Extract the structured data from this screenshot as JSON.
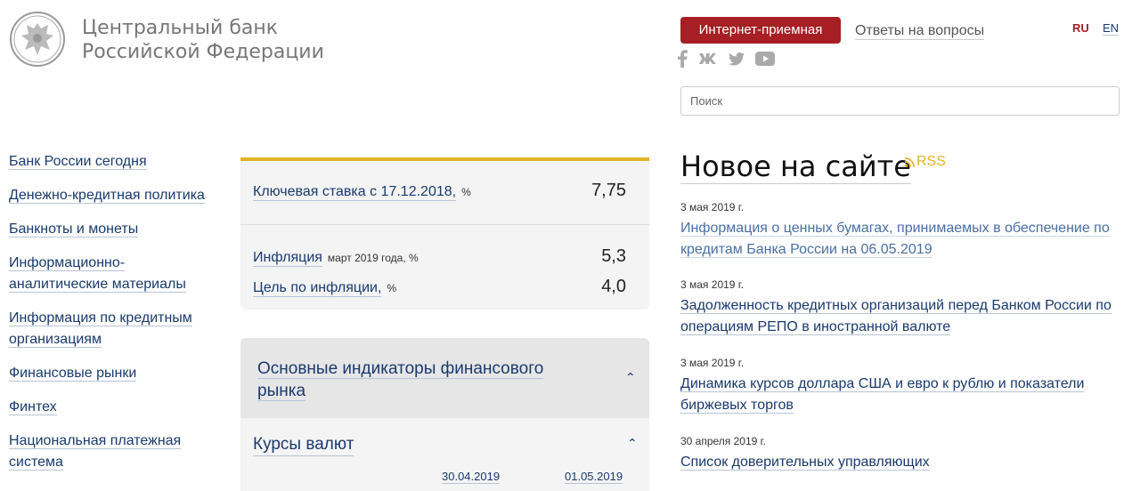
{
  "header": {
    "logo_line1": "Центральный банк",
    "logo_line2": "Российской Федерации",
    "reception_button": "Интернет-приемная",
    "faq_link": "Ответы на вопросы",
    "lang_ru": "RU",
    "lang_en": "EN",
    "search_placeholder": "Поиск",
    "social_icons": [
      "facebook-icon",
      "vk-icon",
      "twitter-icon",
      "youtube-icon"
    ]
  },
  "sidebar": {
    "items": [
      "Банк России сегодня",
      "Денежно-кредитная политика",
      "Банкноты и монеты",
      "Информационно-аналитические материалы",
      "Информация по кредитным организациям",
      "Финансовые рынки",
      "Финтех",
      "Национальная платежная система"
    ]
  },
  "rates": {
    "key_rate_label": "Ключевая ставка с 17.12.2018,",
    "key_rate_unit": "%",
    "key_rate_value": "7,75",
    "inflation_label": "Инфляция",
    "inflation_sub": "март 2019 года, %",
    "inflation_value": "5,3",
    "target_label": "Цель по инфляции,",
    "target_unit": "%",
    "target_value": "4,0"
  },
  "indicators": {
    "title": "Основные индикаторы финансового рынка",
    "fx_title": "Курсы валют",
    "date1": "30.04.2019",
    "date2": "01.05.2019"
  },
  "news": {
    "title": "Новое на сайте",
    "rss": "RSS",
    "items": [
      {
        "date": "3 мая 2019 г.",
        "text": "Информация о ценных бумагах, принимаемых в обеспечение по кредитам Банка России на 06.05.2019"
      },
      {
        "date": "3 мая 2019 г.",
        "text": "Задолженность кредитных организаций перед Банком России по операциям РЕПО в иностранной валюте"
      },
      {
        "date": "3 мая 2019 г.",
        "text": "Динамика курсов доллара США и евро к рублю и показатели биржевых торгов"
      },
      {
        "date": "30 апреля 2019 г.",
        "text": "Список доверительных управляющих"
      }
    ]
  },
  "colors": {
    "accent_red": "#a61f24",
    "accent_gold": "#e2b325",
    "link_blue": "#1a3a6e"
  }
}
